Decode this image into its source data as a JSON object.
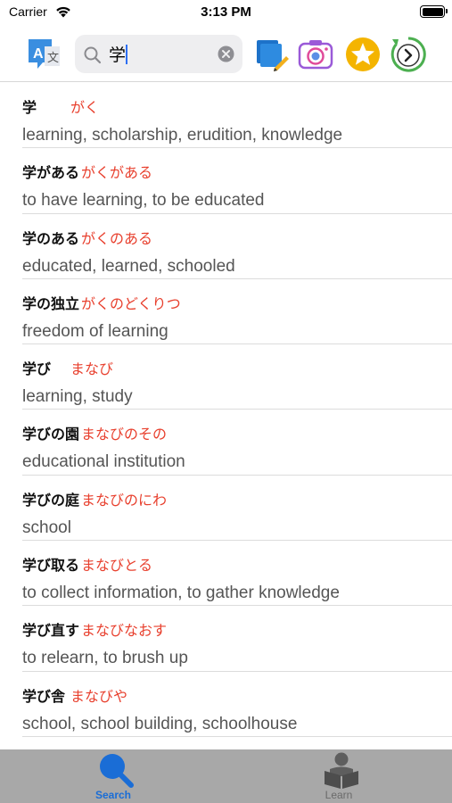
{
  "status_bar": {
    "carrier": "Carrier",
    "time": "3:13 PM"
  },
  "toolbar": {
    "translate_button_icon": "translate-icon",
    "search": {
      "value": "学",
      "placeholder": ""
    },
    "buttons": [
      "edit-icon",
      "camera-icon",
      "star-icon",
      "refresh-icon"
    ],
    "colors": {
      "star": "#f4b400",
      "refresh": "#4caf50",
      "translate": "#3a8ee0"
    }
  },
  "results": [
    {
      "word": "学",
      "reading": "がく",
      "meaning": "learning, scholarship, erudition, knowledge"
    },
    {
      "word": "学がある",
      "reading": "がくがある",
      "meaning": "to have learning, to be educated"
    },
    {
      "word": "学のある",
      "reading": "がくのある",
      "meaning": "educated, learned, schooled"
    },
    {
      "word": "学の独立",
      "reading": "がくのどくりつ",
      "meaning": "freedom of learning"
    },
    {
      "word": "学び",
      "reading": "まなび",
      "meaning": "learning, study"
    },
    {
      "word": "学びの園",
      "reading": "まなびのその",
      "meaning": "educational institution"
    },
    {
      "word": "学びの庭",
      "reading": "まなびのにわ",
      "meaning": "school"
    },
    {
      "word": "学び取る",
      "reading": "まなびとる",
      "meaning": "to collect information, to gather knowledge"
    },
    {
      "word": "学び直す",
      "reading": "まなびなおす",
      "meaning": "to relearn, to brush up"
    },
    {
      "word": "学び舎",
      "reading": "まなびや",
      "meaning": "school, school building, schoolhouse"
    }
  ],
  "tab_bar": {
    "tabs": [
      {
        "label": "Search",
        "icon": "search-icon",
        "selected": true
      },
      {
        "label": "Learn",
        "icon": "reader-icon",
        "selected": false
      }
    ]
  },
  "colors": {
    "reading": "#e8402e",
    "accent": "#1a6dd6",
    "tab_bar": "#a8a8a8"
  }
}
